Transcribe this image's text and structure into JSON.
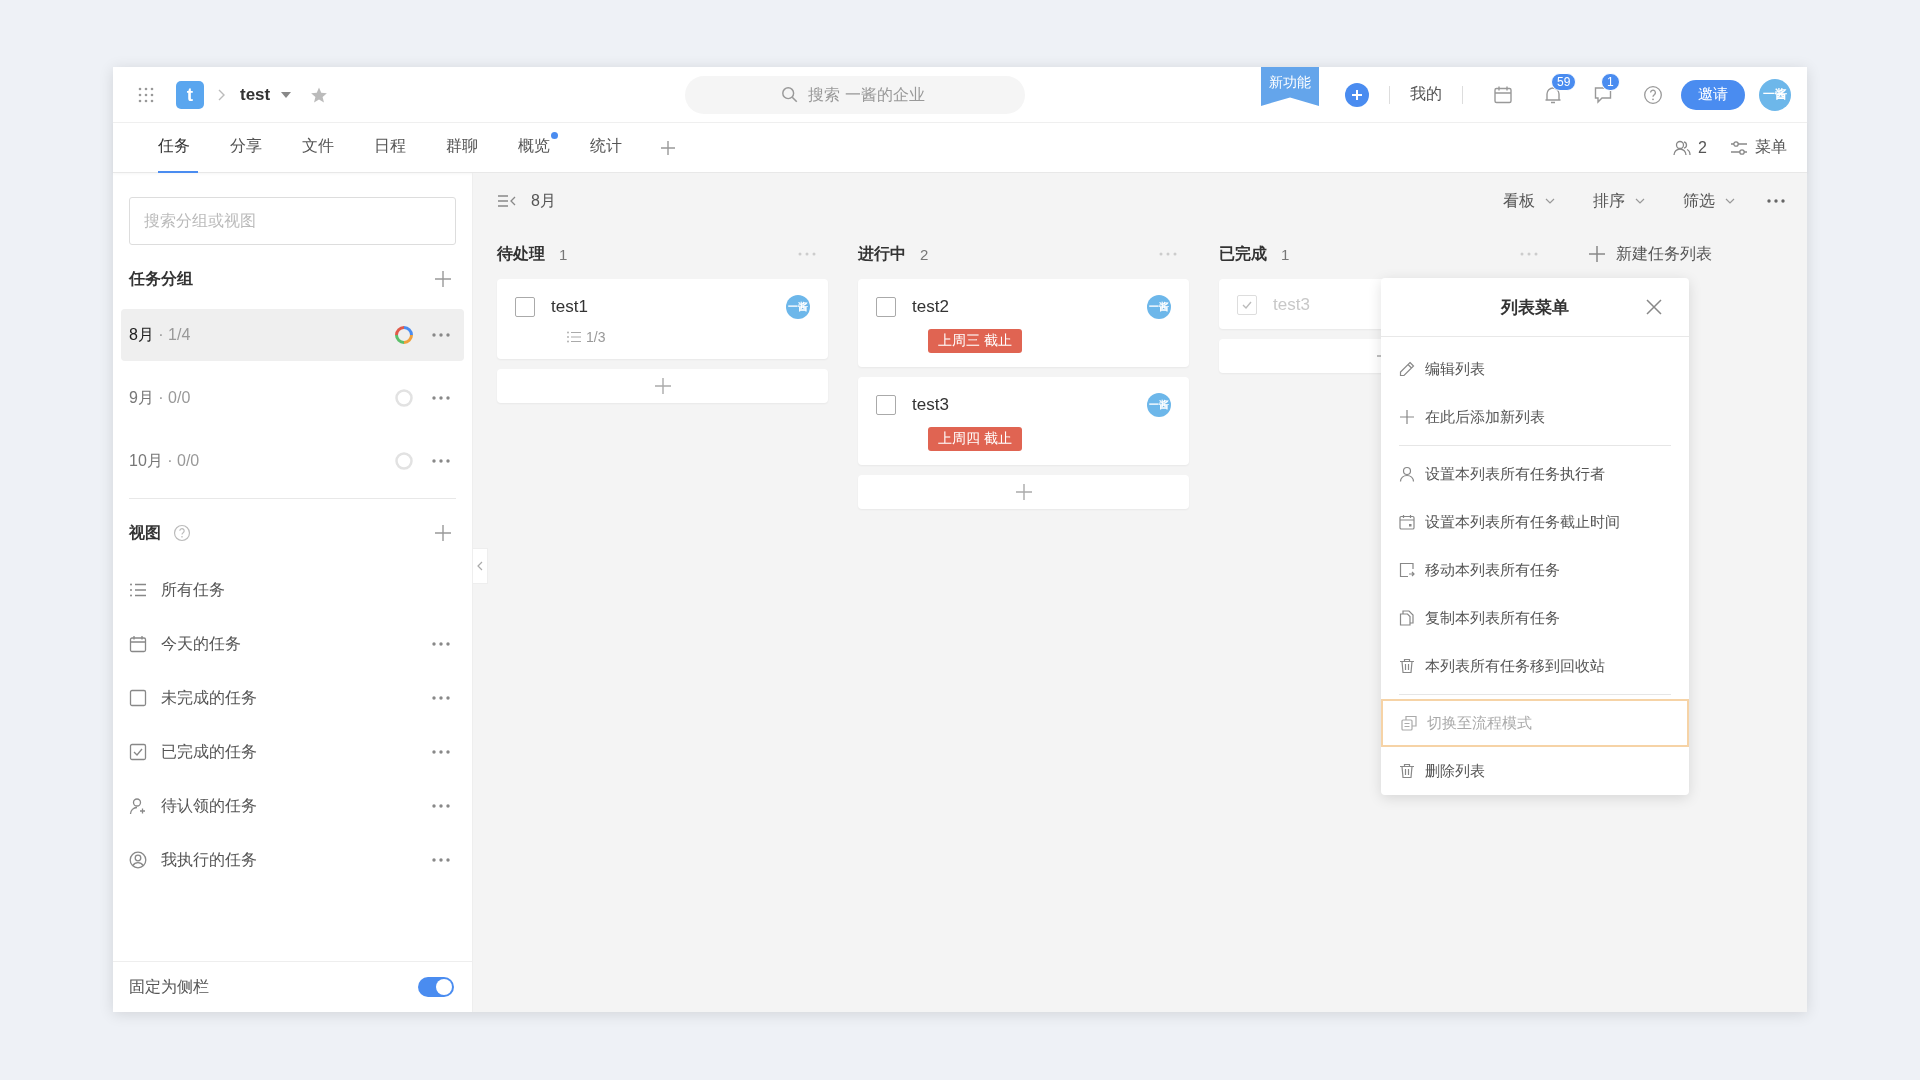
{
  "top_bar": {
    "logo": "t",
    "project": "test",
    "search": {
      "placeholder": "搜索 一酱的企业"
    },
    "ribbon": "新功能",
    "my_link": "我的",
    "notification_badge": "59",
    "message_badge": "1",
    "invite_button": "邀请",
    "avatar": "一酱"
  },
  "tabs": [
    {
      "label": "任务",
      "selected": true,
      "dot": false
    },
    {
      "label": "分享",
      "selected": false,
      "dot": false
    },
    {
      "label": "文件",
      "selected": false,
      "dot": false
    },
    {
      "label": "日程",
      "selected": false,
      "dot": false
    },
    {
      "label": "群聊",
      "selected": false,
      "dot": false
    },
    {
      "label": "概览",
      "selected": false,
      "dot": true
    },
    {
      "label": "统计",
      "selected": false,
      "dot": false
    }
  ],
  "tab_bar_right": {
    "members": "2",
    "menu": "菜单"
  },
  "sidebar": {
    "search": {
      "placeholder": "搜索分组或视图"
    },
    "groups_title": "任务分组",
    "groups": [
      {
        "name": "8月",
        "count": "· 1/4",
        "selected": true,
        "colored": true
      },
      {
        "name": "9月",
        "count": "· 0/0",
        "selected": false,
        "colored": false
      },
      {
        "name": "10月",
        "count": "· 0/0",
        "selected": false,
        "colored": false
      }
    ],
    "views_title": "视图",
    "views": [
      {
        "kind": "list",
        "label": "所有任务",
        "menu": false
      },
      {
        "kind": "calendar",
        "label": "今天的任务",
        "menu": true
      },
      {
        "kind": "box",
        "label": "未完成的任务",
        "menu": true
      },
      {
        "kind": "checked",
        "label": "已完成的任务",
        "menu": true
      },
      {
        "kind": "person-add",
        "label": "待认领的任务",
        "menu": true
      },
      {
        "kind": "person-circle",
        "label": "我执行的任务",
        "menu": true
      }
    ],
    "pin_label": "固定为侧栏",
    "pin_on": true
  },
  "board": {
    "group_title": "8月",
    "toolbar": [
      "看板",
      "排序",
      "筛选"
    ],
    "columns": [
      {
        "title": "待处理",
        "count": "1",
        "cards": [
          {
            "title": "test1",
            "checked": false,
            "subtasks": "1/3",
            "avatar": "一酱"
          }
        ]
      },
      {
        "title": "进行中",
        "count": "2",
        "cards": [
          {
            "title": "test2",
            "checked": false,
            "due": "上周三 截止",
            "avatar": "一酱"
          },
          {
            "title": "test3",
            "checked": false,
            "due": "上周四 截止",
            "avatar": "一酱"
          }
        ]
      },
      {
        "title": "已完成",
        "count": "1",
        "cards": [
          {
            "title": "test3",
            "checked": true
          }
        ]
      }
    ],
    "new_list": "新建任务列表"
  },
  "list_menu": {
    "title": "列表菜单",
    "sections": [
      [
        {
          "kind": "edit",
          "label": "编辑列表",
          "highlighted": false,
          "disabled": false
        },
        {
          "kind": "plus",
          "label": "在此后添加新列表",
          "highlighted": false,
          "disabled": false
        }
      ],
      [
        {
          "kind": "person",
          "label": "设置本列表所有任务执行者",
          "highlighted": false,
          "disabled": false
        },
        {
          "kind": "calendar",
          "label": "设置本列表所有任务截止时间",
          "highlighted": false,
          "disabled": false
        },
        {
          "kind": "move",
          "label": "移动本列表所有任务",
          "highlighted": false,
          "disabled": false
        },
        {
          "kind": "copy",
          "label": "复制本列表所有任务",
          "highlighted": false,
          "disabled": false
        },
        {
          "kind": "trash",
          "label": "本列表所有任务移到回收站",
          "highlighted": false,
          "disabled": false
        }
      ],
      [
        {
          "kind": "flow",
          "label": "切换至流程模式",
          "highlighted": true,
          "disabled": true
        },
        {
          "kind": "trash",
          "label": "删除列表",
          "highlighted": false,
          "disabled": false
        }
      ]
    ]
  }
}
